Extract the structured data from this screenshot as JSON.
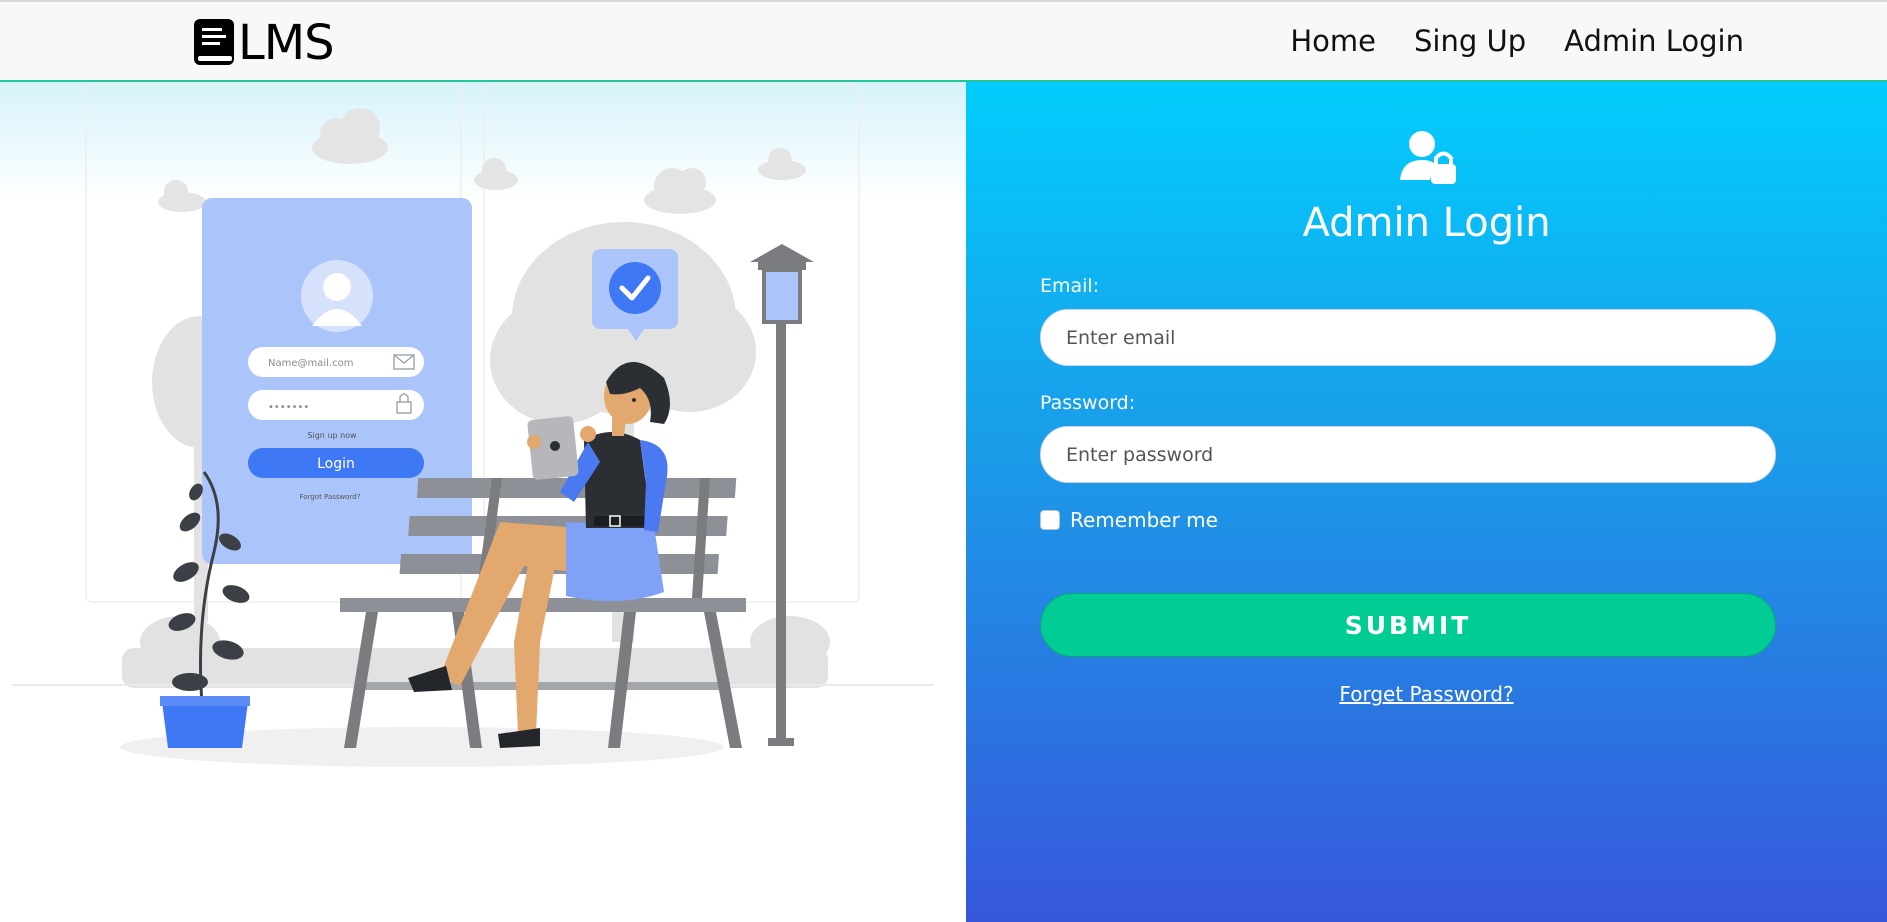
{
  "navbar": {
    "brand": "LMS",
    "links": [
      "Home",
      "Sing Up",
      "Admin Login"
    ]
  },
  "illustration": {
    "email_placeholder": "Name@mail.com",
    "password_mask": "•••••••",
    "signup_text": "Sign up now",
    "login_label": "Login",
    "forgot_text": "Forgot Password?"
  },
  "form": {
    "title": "Admin Login",
    "email_label": "Email:",
    "email_placeholder": "Enter email",
    "password_label": "Password:",
    "password_placeholder": "Enter password",
    "remember_label": "Remember me",
    "submit_label": "SUBMIT",
    "forgot_label": "Forget Password?"
  },
  "colors": {
    "accent_green": "#00cc93",
    "gradient_top": "#02cdfd",
    "gradient_bottom": "#3757db",
    "nav_underline": "#22c79a"
  },
  "icons": {
    "brand": "book-icon",
    "admin": "user-lock-icon"
  }
}
